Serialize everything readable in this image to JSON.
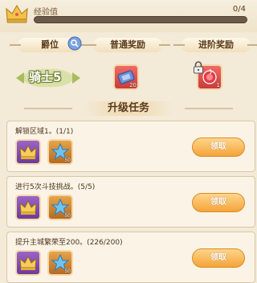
{
  "exp": {
    "label": "经验值",
    "value_text": "0/4",
    "progress": 0
  },
  "headers": {
    "rank": "爵位",
    "normal_reward": "普通奖励",
    "advanced_reward": "进阶奖励"
  },
  "rank": {
    "name": "骑士5"
  },
  "rewards": {
    "normal": {
      "icon": "ticket-icon",
      "count": "20"
    },
    "advanced": {
      "icon": "red-gem-icon",
      "count": "1",
      "locked": true
    }
  },
  "task_section_title": "升级任务",
  "tasks": [
    {
      "desc": "解锁区域1。(1/1)",
      "rewards": [
        {
          "icon": "crown-icon",
          "count": ""
        },
        {
          "icon": "star-icon",
          "count": "50"
        }
      ],
      "button": "领取"
    },
    {
      "desc": "进行5次斗技挑战。(5/5)",
      "rewards": [
        {
          "icon": "crown-icon",
          "count": ""
        },
        {
          "icon": "star-icon",
          "count": "50"
        }
      ],
      "button": "领取"
    },
    {
      "desc": "提升主城繁荣至200。(226/200)",
      "rewards": [
        {
          "icon": "crown-icon",
          "count": ""
        },
        {
          "icon": "star-icon",
          "count": "50"
        }
      ],
      "button": "领取"
    }
  ],
  "colors": {
    "button": "#f4a43a",
    "exp_track": "#6b5a48",
    "background": "#f3ead7"
  }
}
